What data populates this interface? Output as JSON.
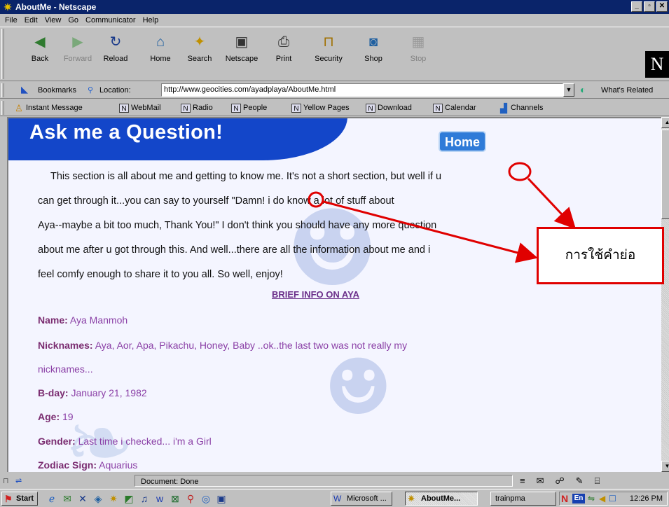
{
  "window": {
    "title": "AboutMe - Netscape"
  },
  "menu": [
    "File",
    "Edit",
    "View",
    "Go",
    "Communicator",
    "Help"
  ],
  "nav": {
    "back": "Back",
    "forward": "Forward",
    "reload": "Reload",
    "home": "Home",
    "search": "Search",
    "netscape": "Netscape",
    "print": "Print",
    "security": "Security",
    "shop": "Shop",
    "stop": "Stop"
  },
  "location": {
    "bookmarks": "Bookmarks",
    "label": "Location:",
    "url": "http://www.geocities.com/ayadplaya/AboutMe.html",
    "related": "What's Related"
  },
  "personal": [
    "Instant Message",
    "WebMail",
    "Radio",
    "People",
    "Yellow Pages",
    "Download",
    "Calendar",
    "Channels"
  ],
  "page": {
    "banner_title": "Ask me a Question!",
    "home_button": "Home",
    "intro": [
      "This section is all about me and getting to know me.  It's not a short section, but well if u",
      "can get through it...you can say to yourself \"Damn! i do know a lot of stuff about",
      "Aya--maybe a bit too much, Thank You!\"  I don't think you should have any more question",
      "about me after u got through this.  And well...there are all the information about me and i",
      "feel comfy enough to share it to you all.  So well, enjoy!"
    ],
    "brief_link": "BRIEF INFO ON AYA",
    "info": [
      {
        "label": "Name:",
        "value": "Aya Manmoh"
      },
      {
        "label": "Nicknames:",
        "value": "Aya, Aor, Apa, Pikachu, Honey, Baby ..ok..the last two was not really my"
      },
      {
        "label": "",
        "value": "nicknames..."
      },
      {
        "label": "B-day:",
        "value": "January 21, 1982"
      },
      {
        "label": "Age:",
        "value": "19"
      },
      {
        "label": "Gender:",
        "value": "Last time i checked... i'm a Girl"
      },
      {
        "label": "Zodiac Sign:",
        "value": "Aquarius"
      }
    ]
  },
  "annotation": {
    "text": "การใช้คำย่อ",
    "color": "#e00000"
  },
  "status": {
    "text": "Document: Done"
  },
  "taskbar": {
    "start": "Start",
    "tasks": [
      "Microsoft ...",
      "AboutMe...",
      "trainpma"
    ],
    "tray_lang": "En",
    "clock": "12:26 PM"
  },
  "colors": {
    "titlebar": "#0a246a",
    "banner": "#1346c9",
    "link": "#6b2f8a",
    "info_value": "#8a3fa6"
  }
}
